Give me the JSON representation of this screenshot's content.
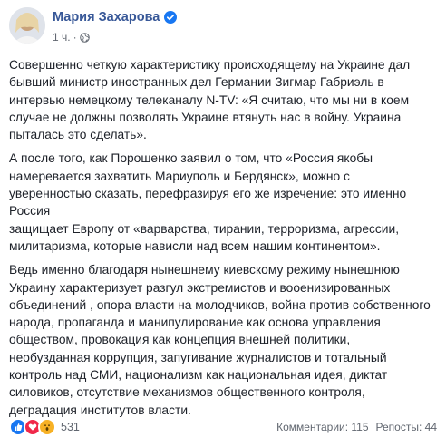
{
  "post": {
    "author": "Мария Захарова",
    "time": "1 ч.",
    "separator": "·",
    "paragraphs": [
      "Совершенно четкую характеристику происходящему на Украине дал\nбывший министр иностранных дел Германии Зигмар Габриэль в\nинтервью немецкому телеканалу N-TV: «Я считаю, что мы ни в коем\nслучае не должны позволять Украине втянуть нас в войну. Украина\nпыталась это сделать».",
      "А после того, как Порошенко заявил о том, что «Россия якобы\nнамеревается захватить Мариуполь и Бердянск», можно с\nуверенностью сказать, перефразируя его же изречение: это именно\nРоссия\nзащищает Европу от «варварства, тирании, терроризма, агрессии,\nмилитаризма, которые нависли над всем нашим континентом».",
      "Ведь именно благодаря нынешнему киевскому режиму нынешнюю\nУкраину характеризует разгул экстремистов и вооенизированных\nобъединений , опора власти на молодчиков, война против собственного\nнарода, пропаганда и манипулирование как основа управления\nобществом, провокация как концепция внешней политики,\nнеобузданная коррупция, запугивание журналистов и тотальный\nконтроль над СМИ, национализм как национальная идея, диктат\nсиловиков, отсутствие механизмов общественного контроля,\nдеградация институтов власти."
    ]
  },
  "footer": {
    "reaction_count": "531",
    "comments": "Комментарии: 115",
    "shares": "Репосты: 44"
  },
  "colors": {
    "name": "#385898",
    "like": "#1877f2",
    "love": "#f0284a",
    "wow": "#f7b125"
  },
  "icons": [
    "verified-icon",
    "globe-icon",
    "like-reaction-icon",
    "love-reaction-icon",
    "wow-reaction-icon"
  ]
}
